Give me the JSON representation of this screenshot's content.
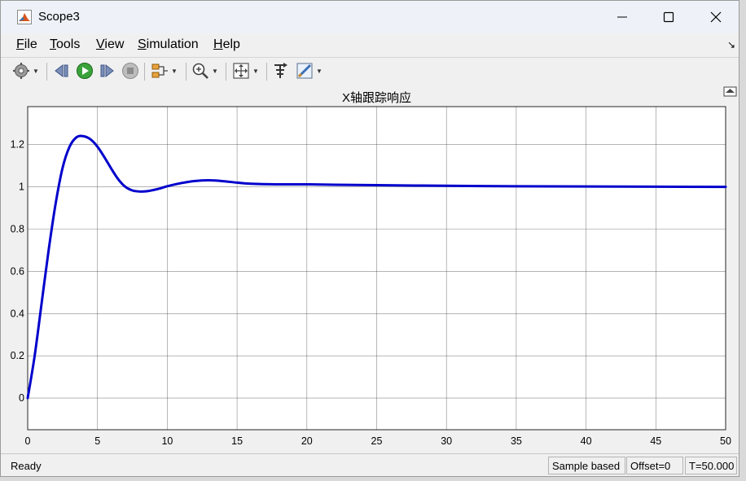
{
  "window": {
    "title": "Scope3"
  },
  "menu": {
    "items": [
      "File",
      "Tools",
      "View",
      "Simulation",
      "Help"
    ]
  },
  "toolbar": {
    "buttons": [
      "gear-icon",
      "step-back-icon",
      "run-icon",
      "step-forward-icon",
      "stop-icon",
      "signal-selector-icon",
      "zoom-icon",
      "autoscale-icon",
      "restore-layout-icon",
      "style-icon"
    ]
  },
  "chart_data": {
    "type": "line",
    "title": "X轴跟踪响应",
    "xlabel": "",
    "ylabel": "",
    "xlim": [
      0,
      50
    ],
    "ylim": [
      -0.15,
      1.38
    ],
    "xticks": [
      0,
      5,
      10,
      15,
      20,
      25,
      30,
      35,
      40,
      45,
      50
    ],
    "yticks": [
      0,
      0.2,
      0.4,
      0.6,
      0.8,
      1,
      1.2
    ],
    "ytick_labels": [
      "0",
      "0.2",
      "0.4",
      "0.6",
      "0.8",
      "1",
      "1.2"
    ],
    "grid": true,
    "series": [
      {
        "color": "#0000cc",
        "x": [
          0,
          0.5,
          1,
          1.5,
          2,
          2.5,
          3,
          3.5,
          4,
          4.5,
          5,
          5.5,
          6,
          6.5,
          7,
          7.5,
          8,
          8.5,
          9,
          9.5,
          10,
          11,
          12,
          13,
          14,
          15,
          16,
          18,
          20,
          22,
          25,
          30,
          35,
          40,
          45,
          50
        ],
        "y": [
          0,
          0.2,
          0.45,
          0.7,
          0.92,
          1.09,
          1.19,
          1.235,
          1.24,
          1.225,
          1.19,
          1.14,
          1.085,
          1.035,
          1.0,
          0.983,
          0.978,
          0.979,
          0.985,
          0.993,
          1.003,
          1.018,
          1.028,
          1.031,
          1.027,
          1.02,
          1.015,
          1.012,
          1.012,
          1.01,
          1.008,
          1.005,
          1.003,
          1.002,
          1.001,
          1.0
        ]
      }
    ]
  },
  "status": {
    "ready": "Ready",
    "sample_mode": "Sample based",
    "offset": "Offset=0",
    "time": "T=50.000"
  }
}
